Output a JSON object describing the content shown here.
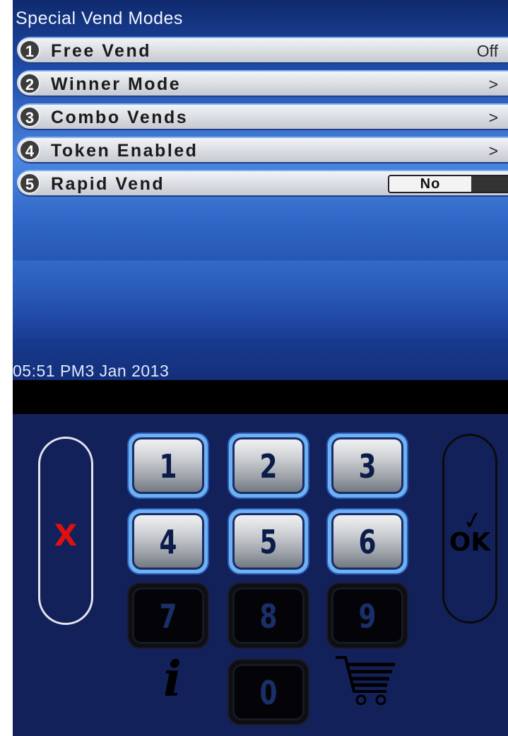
{
  "screen": {
    "title": "Special Vend Modes",
    "menu": [
      {
        "number": "1",
        "label": "Free Vend",
        "value": "Off"
      },
      {
        "number": "2",
        "label": "Winner Mode",
        "value": ">"
      },
      {
        "number": "3",
        "label": "Combo Vends",
        "value": ">"
      },
      {
        "number": "4",
        "label": "Token Enabled",
        "value": ">"
      },
      {
        "number": "5",
        "label": "Rapid Vend",
        "toggle": "No"
      }
    ],
    "datetime": "05:51 PM3 Jan 2013"
  },
  "keypad": {
    "cancel_label": "X",
    "ok_label": "OK",
    "ok_check": "✓",
    "info_symbol": "i",
    "keys": [
      "1",
      "2",
      "3",
      "4",
      "5",
      "6",
      "7",
      "8",
      "9",
      "0"
    ],
    "icons": {
      "cancel": "x-icon",
      "ok": "ok-check-icon",
      "info": "info-icon",
      "cart": "cart-icon"
    },
    "colors": {
      "cancel": "#e01010",
      "active_key_border": "#6db2f2",
      "background": "#13215a"
    }
  }
}
